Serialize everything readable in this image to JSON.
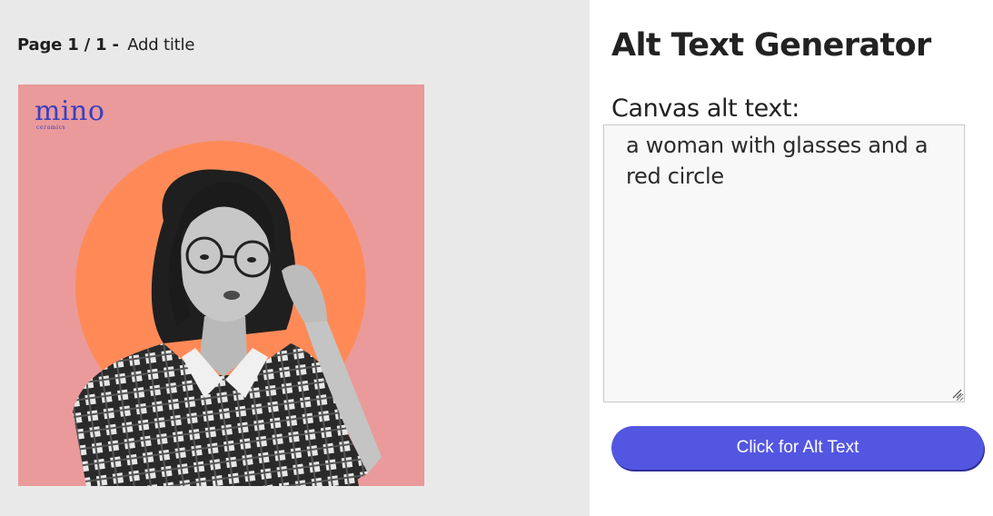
{
  "canvas": {
    "page_label": "Page 1 / 1 -",
    "page_title": "Add title"
  },
  "design": {
    "logo_word": "mino",
    "logo_sub": "ceramics",
    "background_color": "#ea9a9a",
    "circle_color": "#ff8a58"
  },
  "panel": {
    "heading": "Alt Text Generator",
    "field_label": "Canvas alt text:",
    "alt_text_value": "a woman with glasses and a red circle",
    "button_label": "Click for Alt Text",
    "accent_color": "#5356e0"
  }
}
